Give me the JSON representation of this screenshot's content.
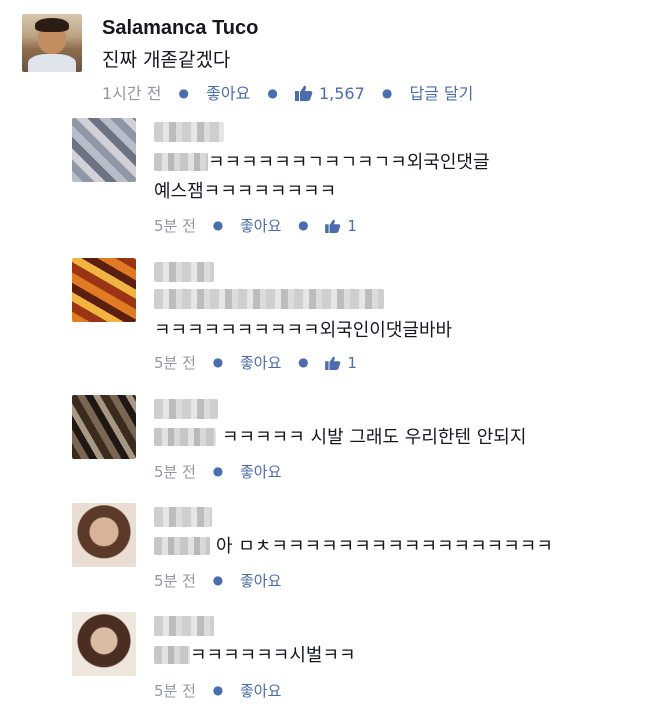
{
  "post": {
    "author": "Salamanca Tuco",
    "text": "진짜 개졷같겠다",
    "time": "1시간 전",
    "like_label": "좋아요",
    "like_count": "1,567",
    "reply_label": "답글 달기"
  },
  "comments": [
    {
      "line1": "ㅋㅋㅋㅋㅋㅋㄱㅋㄱㅋㄱㅋ외국인댓글",
      "line2": "예스잼ㅋㅋㅋㅋㅋㅋㅋㅋ",
      "time": "5분 전",
      "like_label": "좋아요",
      "like_count": "1"
    },
    {
      "line1": "ㅋㅋㅋㅋㅋㅋㅋㅋㅋㅋ외국인이댓글바바",
      "time": "5분 전",
      "like_label": "좋아요",
      "like_count": "1"
    },
    {
      "line1": "ㅋㅋㅋㅋㅋ 시발 그래도 우리한텐 안되지",
      "time": "5분 전",
      "like_label": "좋아요"
    },
    {
      "line1": "아 ㅁㅊㅋㅋㅋㅋㅋㅋㅋㅋㅋㅋㅋㅋㅋㅋㅋㅋㅋ",
      "time": "5분 전",
      "like_label": "좋아요"
    },
    {
      "line1": "ㅋㅋㅋㅋㅋㅋ시벌ㅋㅋ",
      "time": "5분 전",
      "like_label": "좋아요"
    }
  ],
  "colors": {
    "link": "#4b6dad",
    "meta": "#9197a3",
    "text": "#141823"
  }
}
